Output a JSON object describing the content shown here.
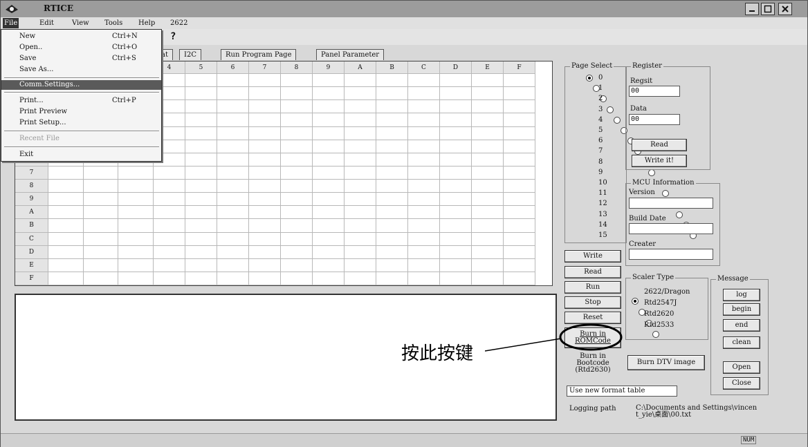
{
  "window": {
    "title": "RTICE"
  },
  "menu": [
    {
      "label": "File"
    },
    {
      "label": "Edit"
    },
    {
      "label": "View"
    },
    {
      "label": "Tools"
    },
    {
      "label": "Help"
    },
    {
      "label": "2622"
    }
  ],
  "file_menu": {
    "new": {
      "label": "New",
      "shortcut": "Ctrl+N"
    },
    "open": {
      "label": "Open..",
      "shortcut": "Ctrl+O"
    },
    "save": {
      "label": "Save",
      "shortcut": "Ctrl+S"
    },
    "save_as": {
      "label": "Save As..."
    },
    "comm_settings": {
      "label": "Comm.Settings..."
    },
    "print": {
      "label": "Print...",
      "shortcut": "Ctrl+P"
    },
    "print_preview": {
      "label": "Print Preview"
    },
    "print_setup": {
      "label": "Print Setup..."
    },
    "recent_file": {
      "label": "Recent File"
    },
    "exit": {
      "label": "Exit"
    }
  },
  "tabs": [
    {
      "label": "at"
    },
    {
      "label": "I2C"
    },
    {
      "label": "Run Program Page"
    },
    {
      "label": "Panel Parameter"
    }
  ],
  "grid": {
    "col_headers": [
      "4",
      "5",
      "6",
      "7",
      "8",
      "9",
      "A",
      "B",
      "C",
      "D",
      "E",
      "F"
    ],
    "row_headers": [
      "7",
      "8",
      "9",
      "A",
      "B",
      "C",
      "D",
      "E",
      "F"
    ]
  },
  "page_select": {
    "legend": "Page Select",
    "pages": [
      "0",
      "1",
      "2",
      "3",
      "4",
      "5",
      "6",
      "7",
      "8",
      "9",
      "10",
      "11",
      "12",
      "13",
      "14",
      "15"
    ],
    "selected": "0"
  },
  "register": {
    "legend": "Register",
    "addr_label": "Regsit",
    "addr_value": "00",
    "data_label": "Data",
    "data_value": "00",
    "read_label": "Read",
    "write_label": "Write it!"
  },
  "mcu_info": {
    "legend": "MCU Information",
    "version_label": "Version",
    "build_date_label": "Build Date",
    "creater_label": "Creater"
  },
  "actions": {
    "write": "Write",
    "read": "Read",
    "run": "Run",
    "stop": "Stop",
    "reset": "Reset",
    "burn_rom": "Burn in ROMCode",
    "burn_boot": "Burn in Bootcode (Rtd2630)",
    "burn_dtv": "Burn DTV image"
  },
  "scaler_type": {
    "legend": "Scaler Type",
    "options": [
      "2622/Dragon",
      "Rtd2547J",
      "Rtd2620",
      "Rtd2533"
    ],
    "selected": "2622/Dragon"
  },
  "message": {
    "legend": "Message",
    "buttons": [
      "log",
      "begin",
      "end",
      "clean",
      "Open",
      "Close"
    ]
  },
  "use_new_format": "Use new format table",
  "logging": {
    "label": "Logging path",
    "path": "C:\\Documents and Settings\\vincent_yie\\桌面\\00.txt"
  },
  "annotation": {
    "text": "按此按键"
  },
  "status": {
    "num": "NUM"
  }
}
